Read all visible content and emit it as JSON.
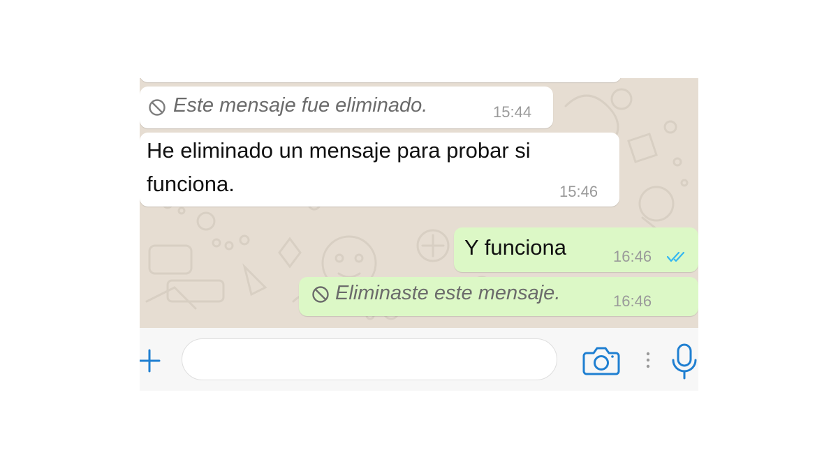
{
  "colors": {
    "chat_background": "#e6ddd2",
    "incoming_bubble": "#ffffff",
    "outgoing_bubble": "#dcf8c6",
    "accent_blue": "#1f7fd1",
    "read_ticks": "#34b7f1"
  },
  "messages": [
    {
      "direction": "incoming",
      "deleted": true,
      "icon": "ban-icon",
      "text": "Este mensaje fue eliminado.",
      "time": "15:44"
    },
    {
      "direction": "incoming",
      "deleted": false,
      "text_line1": "He eliminado un mensaje para probar si",
      "text_line2": "funciona.",
      "time": "15:46"
    },
    {
      "direction": "outgoing",
      "deleted": false,
      "text": "Y funciona",
      "time": "16:46",
      "status": "read-double-tick-icon"
    },
    {
      "direction": "outgoing",
      "deleted": true,
      "icon": "ban-icon",
      "text": "Eliminaste este mensaje.",
      "time": "16:46"
    }
  ],
  "input_bar": {
    "plus_icon": "plus-icon",
    "message_value": "",
    "message_placeholder": "",
    "camera_icon": "camera-icon",
    "more_icon": "vertical-dots-icon",
    "mic_icon": "microphone-icon"
  }
}
